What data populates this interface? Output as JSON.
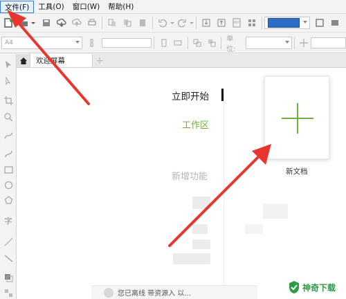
{
  "menu": {
    "items": [
      {
        "label": "文件(F)"
      },
      {
        "label": "工具(O)"
      },
      {
        "label": "窗口(W)"
      },
      {
        "label": "帮助(H)"
      }
    ]
  },
  "toolbar2": {
    "page_size": "A4",
    "unit_label": "单位:"
  },
  "tabs": {
    "doc_tab": "欢迎屏幕"
  },
  "welcome": {
    "start": "立即开始",
    "workspace": "工作区",
    "whats_new": "新增功能",
    "new_document": "新文档"
  },
  "bottom_bar": {
    "text": "您已离线    带资源入 以..."
  },
  "watermark": {
    "text": "神奇下载"
  },
  "colors": {
    "accent_green": "#6fb03c",
    "annotation_red": "#e8362e",
    "fill_color": "#2f6bc9"
  },
  "icons": [
    "new-document-icon",
    "open-folder-icon",
    "save-icon",
    "cloud-upload-icon",
    "print-icon",
    "undo-icon",
    "redo-icon",
    "import-icon",
    "export-icon",
    "pdf-icon",
    "home-icon",
    "plus-icon"
  ]
}
